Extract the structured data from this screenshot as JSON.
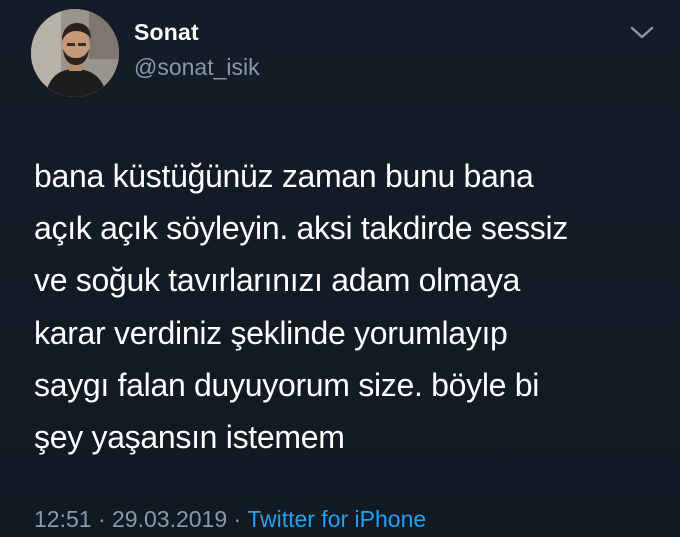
{
  "user": {
    "display_name": "Sonat",
    "handle": "@sonat_isik",
    "avatar_icon": "profile-photo"
  },
  "tweet": {
    "lines": [
      "bana küstüğünüz zaman bunu bana",
      "açık açık söyleyin. aksi takdirde sessiz",
      "ve soğuk tavırlarınızı adam olmaya",
      "karar verdiniz şeklinde yorumlayıp",
      "saygı falan duyuyorum size. böyle bi",
      "şey yaşansın istemem"
    ]
  },
  "meta": {
    "time": "12:51",
    "separator": "·",
    "date": "29.03.2019",
    "source": "Twitter for iPhone"
  },
  "menu": {
    "icon": "chevron-down-icon"
  },
  "colors": {
    "background": "#15202b",
    "muted": "#8899a6",
    "link": "#1da1f2"
  }
}
